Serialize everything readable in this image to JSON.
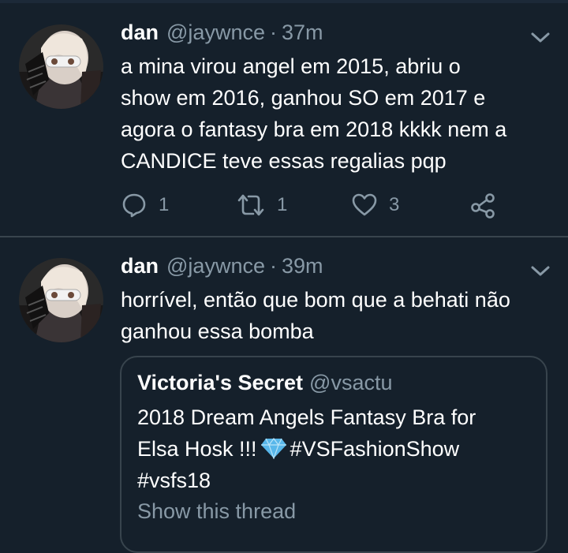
{
  "tweets": [
    {
      "author": {
        "name": "dan",
        "handle": "@jaywnce",
        "avatar_icon": "profile-photo"
      },
      "separator": "·",
      "time": "37m",
      "text_lines": [
        "a mina virou angel em 2015, abriu o",
        "show em 2016, ganhou SO em 2017 e",
        "agora o fantasy bra em 2018 kkkk nem a",
        "CANDICE teve essas regalias pqp"
      ],
      "actions": {
        "replies": "1",
        "retweets": "1",
        "likes": "3"
      }
    },
    {
      "author": {
        "name": "dan",
        "handle": "@jaywnce",
        "avatar_icon": "profile-photo"
      },
      "separator": "·",
      "time": "39m",
      "text_lines": [
        "horrível, então que bom que a behati não",
        "ganhou essa bomba"
      ],
      "quoted_tweet": {
        "name": "Victoria's Secret",
        "handle": "@vsactu",
        "line_1": "2018 Dream Angels Fantasy Bra for",
        "line_2_before": "Elsa Hosk !!!",
        "emoji_icon": "gem-stone-icon",
        "line_2_after": "#VSFashionShow",
        "line_3": "#vsfs18",
        "thread_link": "Show this thread"
      }
    }
  ],
  "colors": {
    "background": "#15202b",
    "divider": "#38444d",
    "secondary_text": "#8899a6",
    "primary_text": "#ffffff",
    "gem": "#58b7ea"
  }
}
